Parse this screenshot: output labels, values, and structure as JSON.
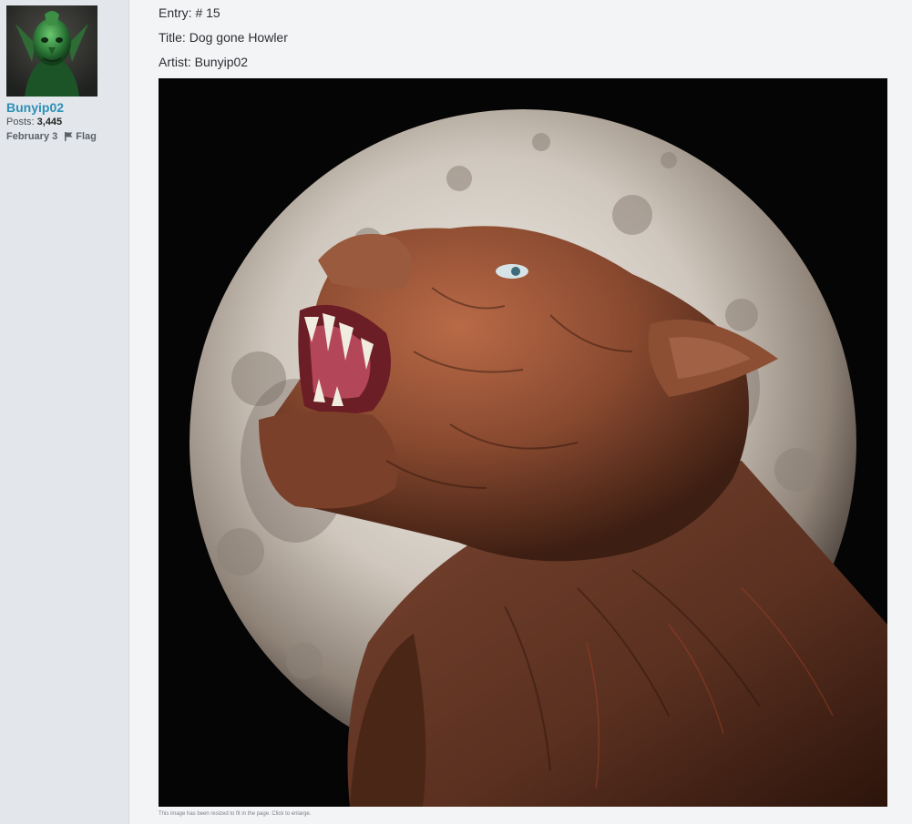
{
  "post": {
    "author": {
      "username": "Bunyip02",
      "posts_label": "Posts:",
      "posts_count": "3,445",
      "date": "February 3",
      "flag_label": "Flag",
      "flag_icon": "flag-icon"
    },
    "entry_line": "Entry: # 15",
    "title_line": "Title: Dog gone Howler",
    "artist_line": "Artist: Bunyip02",
    "resize_note": "This image has been resized to fit in the page. Click to enlarge."
  },
  "colors": {
    "username": "#2b8fb8",
    "sidebar_bg": "#e3e7eb",
    "page_bg": "#f3f4f6",
    "text": "#2d2f33"
  }
}
